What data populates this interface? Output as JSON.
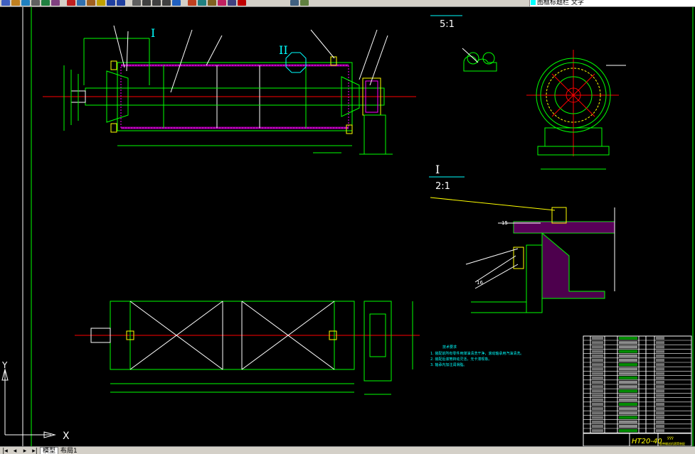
{
  "toolbar": {
    "icons": [
      "new-icon",
      "open-icon",
      "save-icon",
      "print-icon",
      "preview-icon",
      "publish-icon",
      "cut-icon",
      "copy-icon",
      "paste-icon",
      "match-prop-icon",
      "undo-icon",
      "redo-icon",
      "pan-icon",
      "zoom-realtime-icon",
      "zoom-window-icon",
      "zoom-previous-icon",
      "properties-icon",
      "design-center-icon",
      "tool-palette-icon",
      "sheetset-icon",
      "markup-icon",
      "calc-icon",
      "help-icon",
      "layers-icon",
      "layer-state-icon"
    ],
    "layer_name": "图框标题栏 文字",
    "layer_color": "#00ffff"
  },
  "tabs": [
    "模型",
    "布局1"
  ],
  "drawing": {
    "detail_ii_scale": "5:1",
    "detail_i_label": "I",
    "detail_i_scale": "2:1",
    "section_i_mark": "I",
    "section_ii_mark": "II",
    "part_label_15": "15",
    "part_label_16": "16",
    "drawing_number": "HT20-40",
    "axis_x_label": "X",
    "axis_y_label": "Y",
    "title_block_name": "ÿÿÿ",
    "title_block_sub": "皮带输送机滚筒装配",
    "notes_title": "技术要求",
    "notes_line1": "1. 装配前所有零件用煤油清洗干净，滚动轴承用汽油清洗。",
    "notes_line2": "2. 装配后滚筒转动灵活，无卡滞现象。",
    "notes_line3": "3. 轴承内加注润滑脂。"
  }
}
